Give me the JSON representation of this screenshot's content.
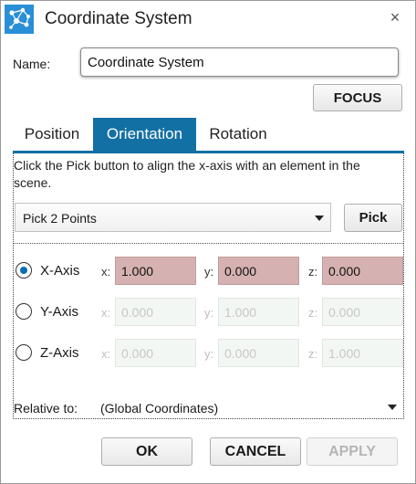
{
  "window": {
    "title": "Coordinate System",
    "close_glyph": "×",
    "icon": "network-nodes-icon",
    "accent_color": "#1370a5"
  },
  "name_field": {
    "label": "Name:",
    "value": "Coordinate System"
  },
  "focus_button": {
    "label": "FOCUS"
  },
  "tabs": [
    {
      "label": "Position",
      "active": false
    },
    {
      "label": "Orientation",
      "active": true
    },
    {
      "label": "Rotation",
      "active": false
    }
  ],
  "orientation": {
    "instruction": "Click the Pick button to align the x-axis with an element in the scene.",
    "pick_mode": {
      "selected": "Pick 2 Points"
    },
    "pick_button": {
      "label": "Pick"
    },
    "axes": [
      {
        "label": "X-Axis",
        "selected": true,
        "x_label": "x:",
        "x": "1.000",
        "y_label": "y:",
        "y": "0.000",
        "z_label": "z:",
        "z": "0.000"
      },
      {
        "label": "Y-Axis",
        "selected": false,
        "x_label": "x:",
        "x": "0.000",
        "y_label": "y:",
        "y": "1.000",
        "z_label": "z:",
        "z": "0.000"
      },
      {
        "label": "Z-Axis",
        "selected": false,
        "x_label": "x:",
        "x": "0.000",
        "y_label": "y:",
        "y": "0.000",
        "z_label": "z:",
        "z": "1.000"
      }
    ],
    "active_field_color": "#d6b1b1",
    "relative_to": {
      "label": "Relative to:",
      "selected": "(Global Coordinates)"
    }
  },
  "footer": {
    "ok_label": "OK",
    "cancel_label": "CANCEL",
    "apply_label": "APPLY",
    "apply_enabled": false
  }
}
